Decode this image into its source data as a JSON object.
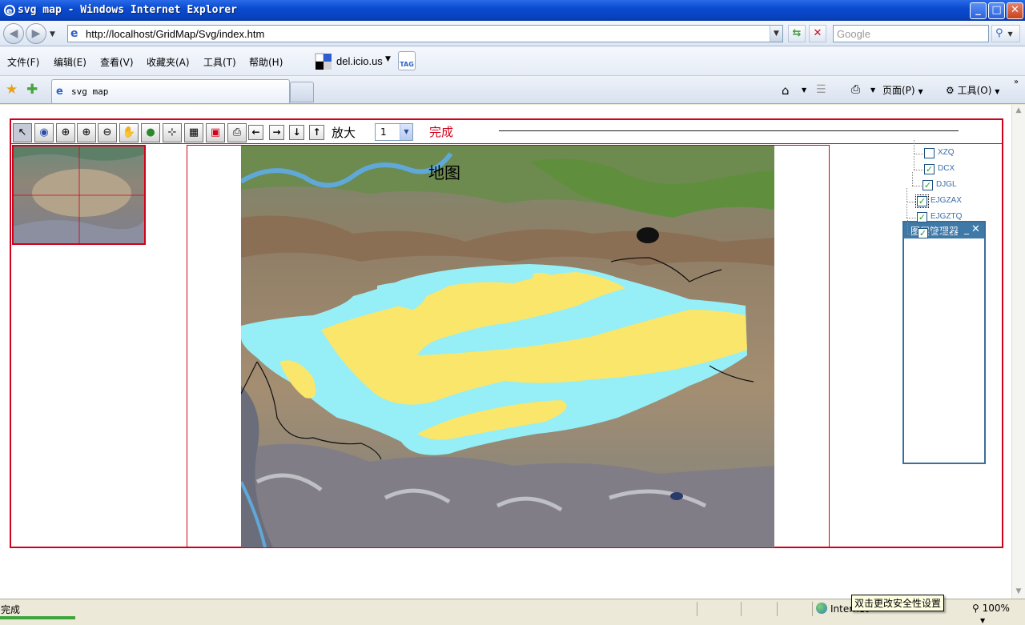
{
  "window": {
    "title": "svg map - Windows Internet Explorer",
    "buttons": {
      "min": "_",
      "max": "□",
      "close": "✕"
    }
  },
  "address_bar": {
    "url": "http://localhost/GridMap/Svg/index.htm",
    "search_placeholder": "Google"
  },
  "menu": {
    "items": [
      "文件(F)",
      "编辑(E)",
      "查看(V)",
      "收藏夹(A)",
      "工具(T)",
      "帮助(H)"
    ],
    "delicious_label": "del.icio.us",
    "tag_label": "TAG"
  },
  "tabs": {
    "active_label": "svg map"
  },
  "command_bar": {
    "page_label": "页面(P)",
    "tools_label": "工具(O)"
  },
  "map_toolbar": {
    "tools": [
      "pointer-icon",
      "eye-icon",
      "zoom-box-icon",
      "zoom-in-icon",
      "zoom-out-icon",
      "pan-hand-icon",
      "globe-icon",
      "measure-icon",
      "area-measure-icon",
      "layer-select-icon",
      "print-icon"
    ],
    "zoom_label": "放大",
    "zoom_value": "1",
    "status_label": "完成"
  },
  "map": {
    "title": "地图"
  },
  "layer_manager": {
    "title": "图层管理器",
    "layers": [
      {
        "name": "XZQ",
        "checked": false
      },
      {
        "name": "DCX",
        "checked": true
      },
      {
        "name": "DJGL",
        "checked": true
      },
      {
        "name": "EJGZAX",
        "checked": true
      },
      {
        "name": "EJGZTQ",
        "checked": true
      },
      {
        "name": "EJGZZJ",
        "checked": true
      }
    ]
  },
  "status_bar": {
    "text": "完成",
    "zone": "Internet",
    "tooltip": "双击更改安全性设置",
    "zoom": "100%"
  },
  "colors": {
    "frame_red": "#d0021b",
    "basin_cyan": "#96eef7",
    "basin_yellow": "#fae66a",
    "panel_blue": "#3f79a8"
  }
}
